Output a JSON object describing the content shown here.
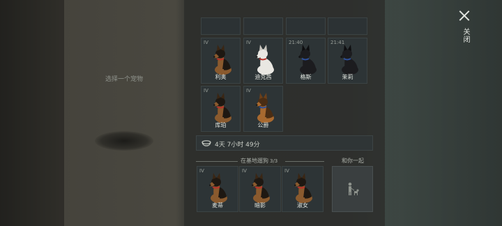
{
  "hint": "选择一个宠物",
  "close_label": "关闭",
  "top_row_slots": [
    {},
    {},
    {},
    {}
  ],
  "pets": [
    {
      "tag": "IV",
      "name": "利奥",
      "coat": "shepherd"
    },
    {
      "tag": "IV",
      "name": "迪克茜",
      "coat": "white"
    },
    {
      "tag": "21:40",
      "name": "格斯",
      "coat": "black"
    },
    {
      "tag": "21:41",
      "name": "茉莉",
      "coat": "black"
    },
    {
      "tag": "IV",
      "name": "库珀",
      "coat": "shepherd"
    },
    {
      "tag": "IV",
      "name": "公爵",
      "coat": "tan"
    }
  ],
  "timer": "4天 7小时 49分",
  "base_section": {
    "label": "在基地遛狗",
    "count": "3/3"
  },
  "base_pets": [
    {
      "tag": "IV",
      "name": "麦蒂",
      "coat": "shepherd"
    },
    {
      "tag": "IV",
      "name": "暗影",
      "coat": "shepherd"
    },
    {
      "tag": "IV",
      "name": "淑女",
      "coat": "shepherd"
    }
  ],
  "with_you_label": "和你一起",
  "colors": {
    "shepherd": "#8a5a2e",
    "tan": "#a8692f",
    "white": "#e9e7e2",
    "black": "#1c1c1f",
    "collar_red": "#b8322a",
    "collar_blue": "#2d4f9a"
  }
}
